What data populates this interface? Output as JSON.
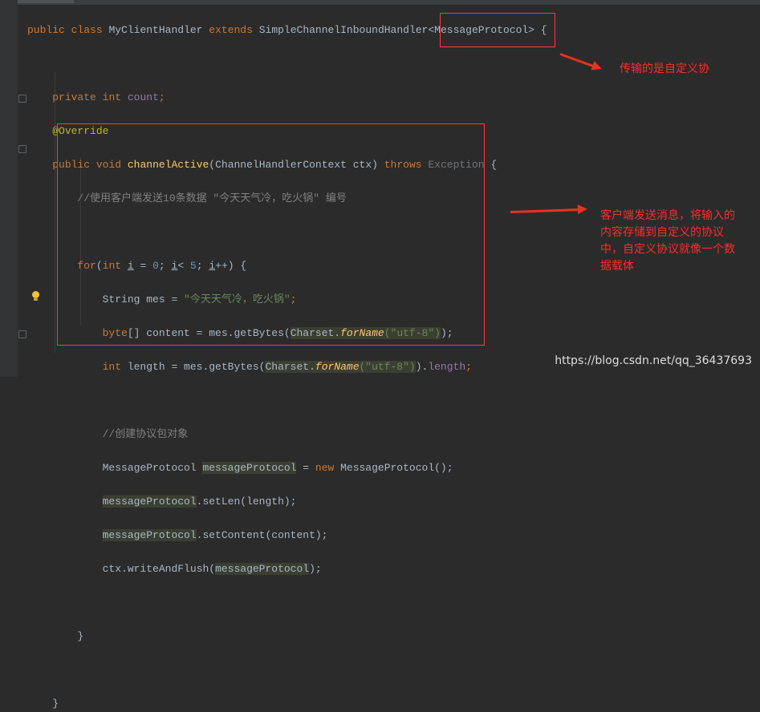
{
  "editor": {
    "lines": {
      "l1_kw1": "public",
      "l1_kw2": "class",
      "l1_name": "MyClientHandler",
      "l1_kw3": "extends",
      "l1_parent": "SimpleChannelInboundHandler",
      "l1_generic": "<MessageProtocol>",
      "l1_brace": "{",
      "l2_kw1": "private",
      "l2_kw2": "int",
      "l2_field": "count",
      "l2_semi": ";",
      "l3_annotation": "@Override",
      "l4_kw1": "public",
      "l4_kw2": "void",
      "l4_method": "channelActive",
      "l4_params": "(ChannelHandlerContext ctx)",
      "l4_throws": "throws",
      "l4_exception": "Exception",
      "l4_brace": "{",
      "l5_comment": "//使用客户端发送10条数据 \"今天天气冷，吃火锅\" 编号",
      "l6_for": "for",
      "l6_open": "(",
      "l6_int": "int",
      "l6_i1": "i",
      "l6_eq": " = ",
      "l6_zero": "0",
      "l6_semi1": "; ",
      "l6_i2": "i",
      "l6_lt": "< ",
      "l6_five": "5",
      "l6_semi2": "; ",
      "l6_i3": "i",
      "l6_close": "++) {",
      "l7_a": "String mes = ",
      "l7_str": "\"今天天气冷，吃火锅\"",
      "l7_semi": ";",
      "l8_kw": "byte",
      "l8_a": "[] content = mes.getBytes(",
      "l8_charset": "Charset.",
      "l8_forname": "forName",
      "l8_str": "(\"utf-8\")",
      "l8_end": ");",
      "l9_kw": "int",
      "l9_a": " length = mes.getBytes(",
      "l9_charset": "Charset.",
      "l9_forname": "forName",
      "l9_str": "(\"utf-8\")",
      "l9_b": ").",
      "l9_len": "length",
      "l9_semi": ";",
      "l10_comment": "//创建协议包对象",
      "l11_a": "MessageProtocol ",
      "l11_var": "messageProtocol",
      "l11_b": " = ",
      "l11_new": "new",
      "l11_c": " MessageProtocol();",
      "l12_var": "messageProtocol",
      "l12_call": ".setLen(length);",
      "l13_var": "messageProtocol",
      "l13_call": ".setContent(content);",
      "l14_a": "ctx.writeAndFlush(",
      "l14_var": "messageProtocol",
      "l14_b": ");",
      "l15_brace": "}",
      "l16_brace": "}"
    }
  },
  "annotations": {
    "note1": "传输的是自定义协",
    "note2_line1": "客户端发送消息，将输入的",
    "note2_line2": "内容存储到自定义的协议",
    "note2_line3": "中，自定义协议就像一个数",
    "note2_line4": "据载体"
  },
  "watermark": "https://blog.csdn.net/qq_36437693",
  "colors": {
    "background": "#2b2b2b",
    "annotation_red": "#ff2b2b",
    "keyword": "#cc7832",
    "string": "#6a8759"
  },
  "icons": [
    "fold-marker-icon",
    "lightbulb-icon",
    "arrow-icon"
  ]
}
